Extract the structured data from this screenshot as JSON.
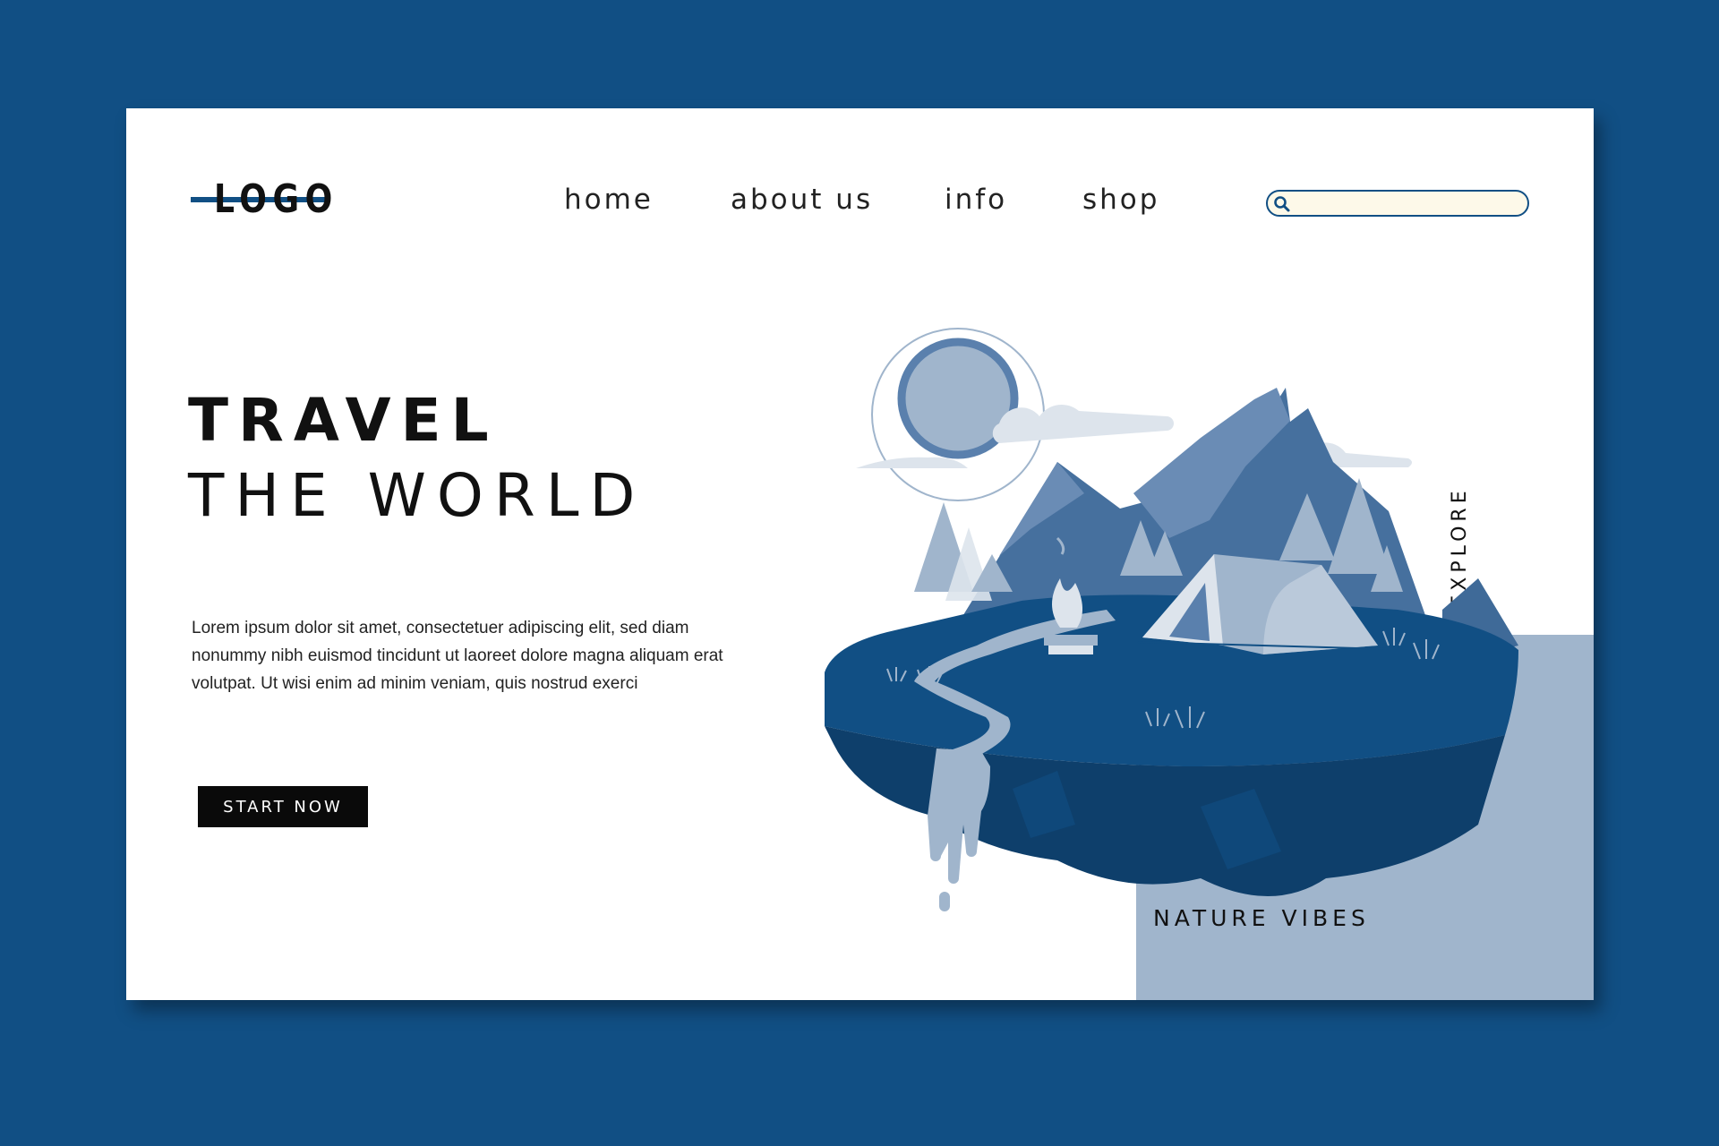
{
  "logo": {
    "text": "LOGO"
  },
  "nav": {
    "items": [
      {
        "label": "home"
      },
      {
        "label": "about us"
      },
      {
        "label": "info"
      },
      {
        "label": "shop"
      }
    ]
  },
  "search": {
    "placeholder": "",
    "value": ""
  },
  "hero": {
    "title_line1": "TRAVEL",
    "title_line2": "THE WORLD",
    "description": "Lorem ipsum dolor sit amet, consectetuer adipiscing elit, sed diam nonummy nibh euismod tincidunt ut laoreet dolore magna aliquam erat volutpat. Ut wisi enim ad minim veniam, quis nostrud exerci",
    "cta_label": "START NOW"
  },
  "side_label": "EXPLORE",
  "panel_label": "NATURE VIBES",
  "colors": {
    "background": "#114f84",
    "card": "#ffffff",
    "panel": "#a0b5cc",
    "accent": "#114f84",
    "button": "#0a0a0a",
    "search_fill": "#fdf9e9"
  },
  "illustration": {
    "subject": [
      "moon",
      "clouds",
      "mountains",
      "pine-trees",
      "tent",
      "campfire",
      "river",
      "waterfall",
      "floating-island"
    ]
  }
}
